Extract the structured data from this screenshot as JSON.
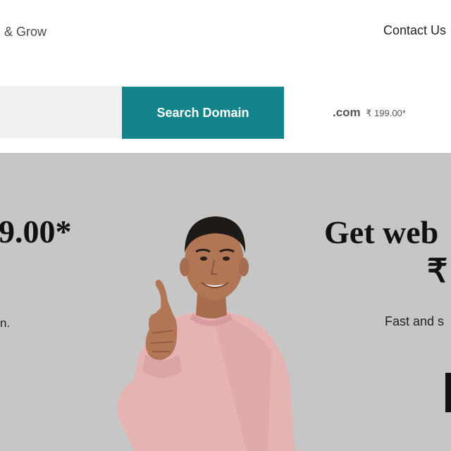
{
  "header": {
    "tagline_fragment": "& Grow",
    "contact_link": "Contact Us"
  },
  "search": {
    "input_value": "",
    "button_label": "Search Domain",
    "tld": ".com",
    "tld_price": "₹ 199.00*"
  },
  "hero": {
    "left_price_fragment": "9.00*",
    "left_tail_fragment": "n.",
    "right_title_fragment": "Get web",
    "right_rupee_fragment": "₹",
    "right_sub_fragment": "Fast and s"
  },
  "colors": {
    "accent": "#12848a",
    "hero_bg": "#c6c6c6",
    "search_bg": "#f0f0f0"
  }
}
